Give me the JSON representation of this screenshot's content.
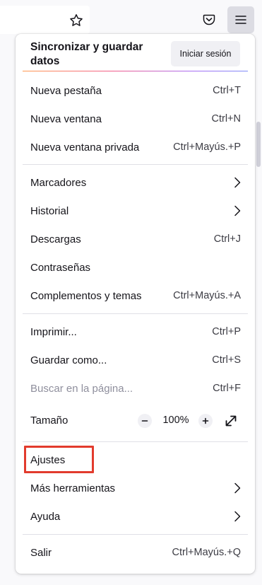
{
  "toolbar": {
    "star_icon": "star-icon",
    "pocket_icon": "pocket-icon",
    "menu_icon": "hamburger-menu-icon"
  },
  "menu": {
    "sync": {
      "title": "Sincronizar y guardar datos",
      "signin_label": "Iniciar sesión"
    },
    "new_tab": {
      "label": "Nueva pestaña",
      "accel": "Ctrl+T"
    },
    "new_window": {
      "label": "Nueva ventana",
      "accel": "Ctrl+N"
    },
    "new_private_window": {
      "label": "Nueva ventana privada",
      "accel": "Ctrl+Mayús.+P"
    },
    "bookmarks": {
      "label": "Marcadores"
    },
    "history": {
      "label": "Historial"
    },
    "downloads": {
      "label": "Descargas",
      "accel": "Ctrl+J"
    },
    "passwords": {
      "label": "Contraseñas"
    },
    "addons": {
      "label": "Complementos y temas",
      "accel": "Ctrl+Mayús.+A"
    },
    "print": {
      "label": "Imprimir...",
      "accel": "Ctrl+P"
    },
    "save_as": {
      "label": "Guardar como...",
      "accel": "Ctrl+S"
    },
    "find": {
      "label": "Buscar en la página...",
      "accel": "Ctrl+F"
    },
    "zoom": {
      "label": "Tamaño",
      "value": "100%"
    },
    "settings": {
      "label": "Ajustes"
    },
    "more_tools": {
      "label": "Más herramientas"
    },
    "help": {
      "label": "Ayuda"
    },
    "exit": {
      "label": "Salir",
      "accel": "Ctrl+Mayús.+Q"
    }
  },
  "colors": {
    "highlight_border": "#e23b2d",
    "panel_bg": "#ffffff",
    "menu_button_active": "#dcdce3"
  }
}
